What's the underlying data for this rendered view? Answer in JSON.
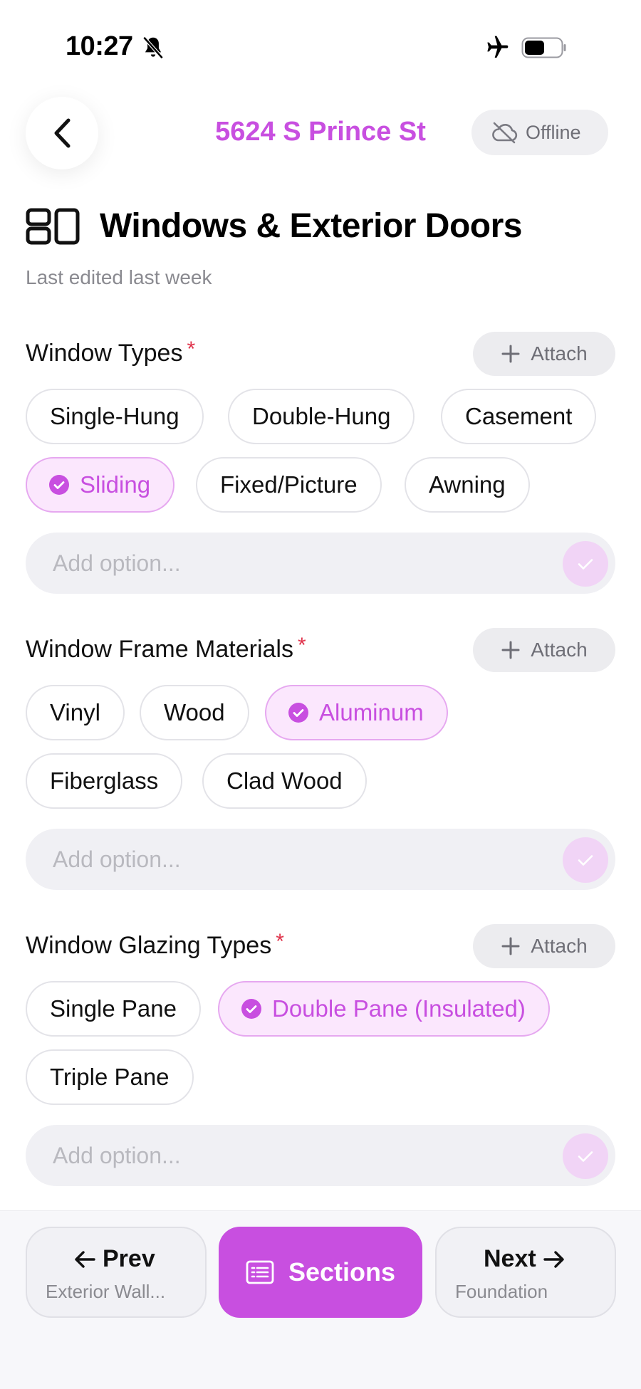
{
  "status_bar": {
    "time": "10:27"
  },
  "header": {
    "title": "5624 S Prince St",
    "offline_label": "Offline"
  },
  "page": {
    "title": "Windows & Exterior Doors",
    "subtitle": "Last edited last week"
  },
  "attach_label": "Attach",
  "required_mark": "*",
  "add_option_placeholder": "Add option...",
  "accent_color": "#c84fe0",
  "sections": [
    {
      "label": "Window Types",
      "options": [
        "Single-Hung",
        "Double-Hung",
        "Casement",
        "Sliding",
        "Fixed/Picture",
        "Awning"
      ],
      "selected": "Sliding"
    },
    {
      "label": "Window Frame Materials",
      "options": [
        "Vinyl",
        "Wood",
        "Aluminum",
        "Fiberglass",
        "Clad Wood"
      ],
      "selected": "Aluminum"
    },
    {
      "label": "Window Glazing Types",
      "options": [
        "Single Pane",
        "Double Pane (Insulated)",
        "Triple Pane"
      ],
      "selected": "Double Pane (Insulated)"
    }
  ],
  "footer": {
    "prev": {
      "label": "Prev",
      "sublabel": "Exterior Wall..."
    },
    "sections_label": "Sections",
    "next": {
      "label": "Next",
      "sublabel": "Foundation"
    }
  }
}
